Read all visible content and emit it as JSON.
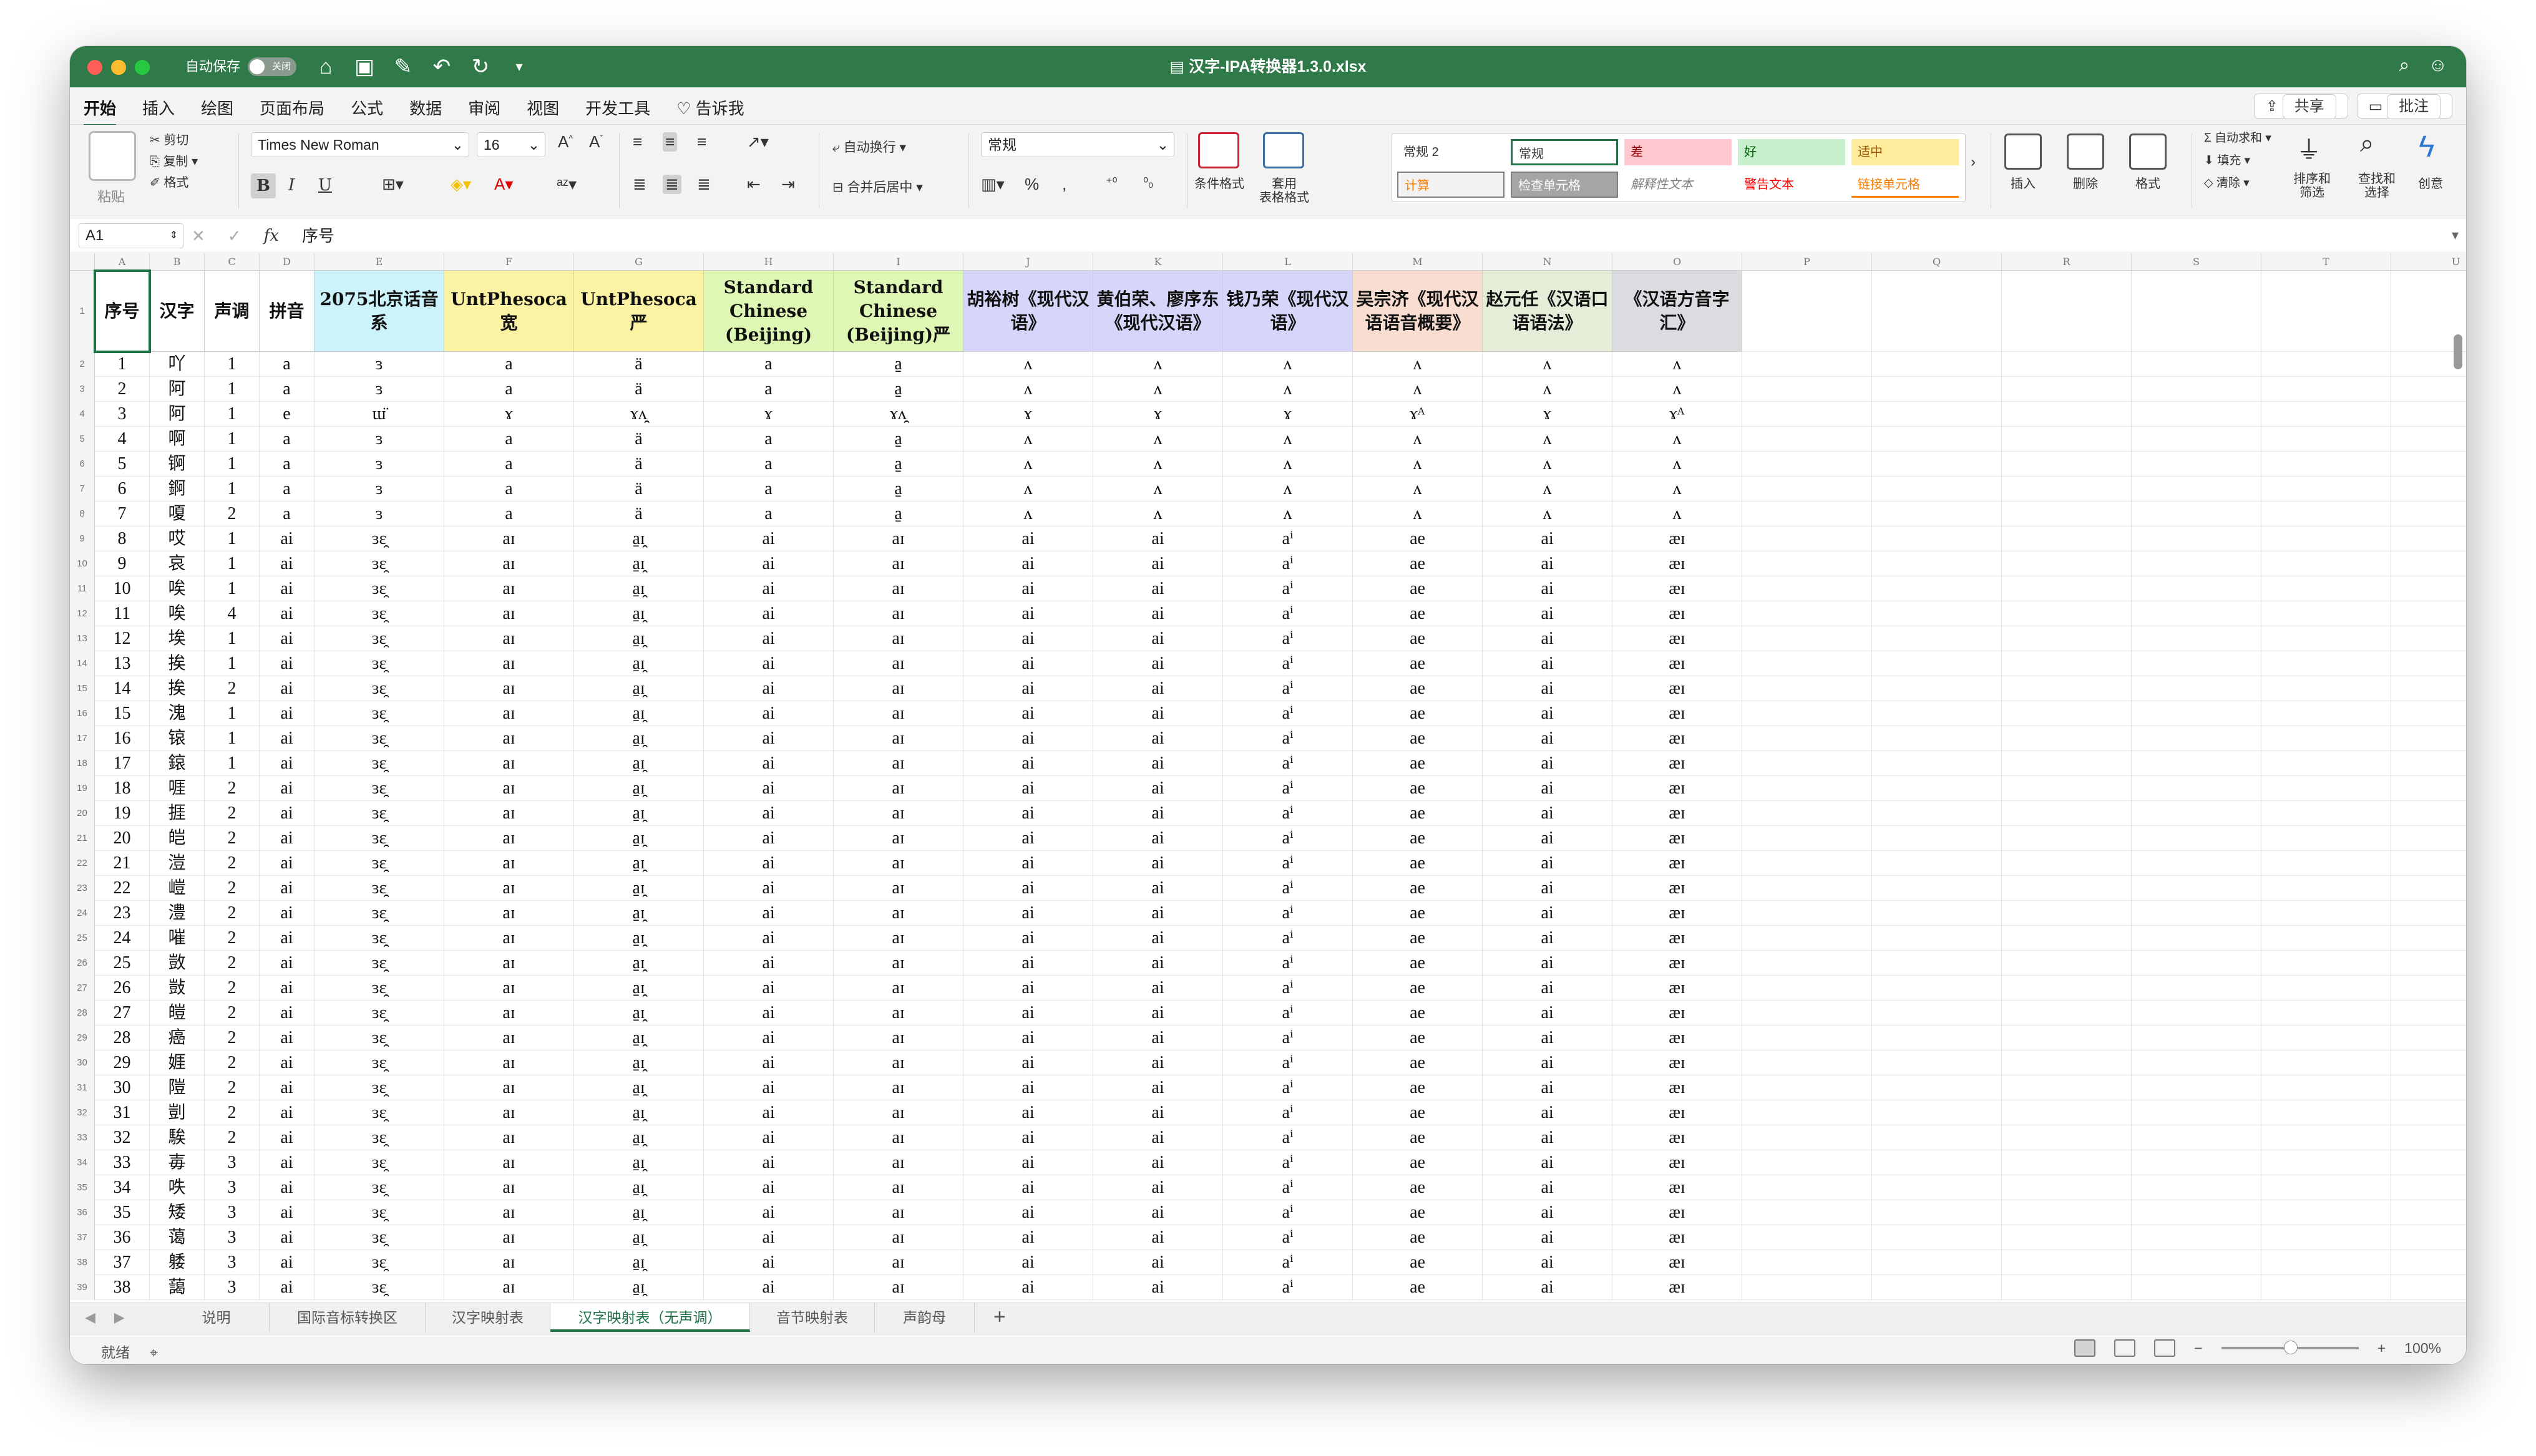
{
  "titlebar": {
    "autosave_label": "自动保存",
    "autosave_state": "关闭",
    "title": "汉字-IPA转换器1.3.0.xlsx"
  },
  "ribbon_tabs": [
    "开始",
    "插入",
    "绘图",
    "页面布局",
    "公式",
    "数据",
    "审阅",
    "视图",
    "开发工具",
    "告诉我"
  ],
  "share": {
    "share_label": "共享",
    "comment_label": "批注"
  },
  "clipboard": {
    "paste": "粘贴",
    "cut": "剪切",
    "copy": "复制",
    "format": "格式"
  },
  "font": {
    "name": "Times New Roman",
    "size": "16",
    "bold": "B",
    "italic": "I",
    "underline": "U"
  },
  "alignment": {
    "wrap": "自动换行",
    "merge": "合并后居中"
  },
  "number": {
    "format": "常规"
  },
  "styles": {
    "conditional": "条件格式",
    "table": "套用\n表格格式",
    "cells": [
      {
        "label": "常规 2",
        "bg": "#ffffff",
        "color": "#333333"
      },
      {
        "label": "常规",
        "bg": "#ffffff",
        "color": "#333333"
      },
      {
        "label": "差",
        "bg": "#ffc7ce",
        "color": "#9c0006"
      },
      {
        "label": "好",
        "bg": "#c6efce",
        "color": "#006100"
      },
      {
        "label": "适中",
        "bg": "#ffeb9c",
        "color": "#9c5700"
      },
      {
        "label": "计算",
        "bg": "#f2f2f2",
        "color": "#fa7d00"
      },
      {
        "label": "检查单元格",
        "bg": "#a5a5a5",
        "color": "#ffffff"
      },
      {
        "label": "解释性文本",
        "bg": "#ffffff",
        "color": "#7f7f7f"
      },
      {
        "label": "警告文本",
        "bg": "#ffffff",
        "color": "#ff0000"
      },
      {
        "label": "链接单元格",
        "bg": "#ffffff",
        "color": "#fa7d00"
      }
    ]
  },
  "cells_group": {
    "insert": "插入",
    "delete": "删除",
    "format": "格式"
  },
  "editing": {
    "autosum": "自动求和",
    "fill": "填充",
    "clear": "清除",
    "sort": "排序和\n筛选",
    "find": "查找和\n选择",
    "ideas": "创意"
  },
  "formula_bar": {
    "name_box": "A1",
    "fx": "fx",
    "content": "序号"
  },
  "columns": [
    "A",
    "B",
    "C",
    "D",
    "E",
    "F",
    "G",
    "H",
    "I",
    "J",
    "K",
    "L",
    "M",
    "N",
    "O",
    "P",
    "Q",
    "R",
    "S",
    "T",
    "U"
  ],
  "headers": [
    {
      "text": "序号",
      "bg": "#ffffff"
    },
    {
      "text": "汉字",
      "bg": "#ffffff"
    },
    {
      "text": "声调",
      "bg": "#ffffff"
    },
    {
      "text": "拼音",
      "bg": "#ffffff"
    },
    {
      "text": "2075北京话音系",
      "bg": "#ccf3fb"
    },
    {
      "text": "UntPhesoca宽",
      "bg": "#fbf3a3"
    },
    {
      "text": "UntPhesoca严",
      "bg": "#fbf3a3"
    },
    {
      "text": "Standard Chinese (Beijing)",
      "bg": "#dff7b4"
    },
    {
      "text": "Standard Chinese (Beijing)严",
      "bg": "#dff7b4"
    },
    {
      "text": "胡裕树《现代汉语》",
      "bg": "#d6d6fb"
    },
    {
      "text": "黄伯荣、廖序东《现代汉语》",
      "bg": "#d6d6fb"
    },
    {
      "text": "钱乃荣《现代汉语》",
      "bg": "#d6d6fb"
    },
    {
      "text": "吴宗济《现代汉语语音概要》",
      "bg": "#f8ddd0"
    },
    {
      "text": "赵元任《汉语口语语法》",
      "bg": "#e4edd8"
    },
    {
      "text": "《汉语方音字汇》",
      "bg": "#dadce0"
    }
  ],
  "rows": [
    [
      "1",
      "吖",
      "1",
      "a",
      "ɜ",
      "a",
      "ä",
      "a",
      "a̠",
      "ʌ",
      "ʌ",
      "ʌ",
      "ʌ",
      "ʌ",
      "ʌ"
    ],
    [
      "2",
      "阿",
      "1",
      "a",
      "ɜ",
      "a",
      "ä",
      "a",
      "a̠",
      "ʌ",
      "ʌ",
      "ʌ",
      "ʌ",
      "ʌ",
      "ʌ"
    ],
    [
      "3",
      "阿",
      "1",
      "e",
      "ɯ̈",
      "ɤ",
      "ɤʌ̯",
      "ɤ",
      "ɤʌ̯",
      "ɤ",
      "ɤ",
      "ɤ",
      "ɤᴬ",
      "ɤ",
      "ɤᴬ"
    ],
    [
      "4",
      "啊",
      "1",
      "a",
      "ɜ",
      "a",
      "ä",
      "a",
      "a̠",
      "ʌ",
      "ʌ",
      "ʌ",
      "ʌ",
      "ʌ",
      "ʌ"
    ],
    [
      "5",
      "锕",
      "1",
      "a",
      "ɜ",
      "a",
      "ä",
      "a",
      "a̠",
      "ʌ",
      "ʌ",
      "ʌ",
      "ʌ",
      "ʌ",
      "ʌ"
    ],
    [
      "6",
      "錒",
      "1",
      "a",
      "ɜ",
      "a",
      "ä",
      "a",
      "a̠",
      "ʌ",
      "ʌ",
      "ʌ",
      "ʌ",
      "ʌ",
      "ʌ"
    ],
    [
      "7",
      "嗄",
      "2",
      "a",
      "ɜ",
      "a",
      "ä",
      "a",
      "a̠",
      "ʌ",
      "ʌ",
      "ʌ",
      "ʌ",
      "ʌ",
      "ʌ"
    ],
    [
      "8",
      "哎",
      "1",
      "ai",
      "ɜɛ̯",
      "aɪ",
      "a̠ɪ̯",
      "ai",
      "aɪ",
      "ai",
      "ai",
      "aⁱ",
      "ae",
      "ai",
      "æɪ"
    ],
    [
      "9",
      "哀",
      "1",
      "ai",
      "ɜɛ̯",
      "aɪ",
      "a̠ɪ̯",
      "ai",
      "aɪ",
      "ai",
      "ai",
      "aⁱ",
      "ae",
      "ai",
      "æɪ"
    ],
    [
      "10",
      "唉",
      "1",
      "ai",
      "ɜɛ̯",
      "aɪ",
      "a̠ɪ̯",
      "ai",
      "aɪ",
      "ai",
      "ai",
      "aⁱ",
      "ae",
      "ai",
      "æɪ"
    ],
    [
      "11",
      "唉",
      "4",
      "ai",
      "ɜɛ̯",
      "aɪ",
      "a̠ɪ̯",
      "ai",
      "aɪ",
      "ai",
      "ai",
      "aⁱ",
      "ae",
      "ai",
      "æɪ"
    ],
    [
      "12",
      "埃",
      "1",
      "ai",
      "ɜɛ̯",
      "aɪ",
      "a̠ɪ̯",
      "ai",
      "aɪ",
      "ai",
      "ai",
      "aⁱ",
      "ae",
      "ai",
      "æɪ"
    ],
    [
      "13",
      "挨",
      "1",
      "ai",
      "ɜɛ̯",
      "aɪ",
      "a̠ɪ̯",
      "ai",
      "aɪ",
      "ai",
      "ai",
      "aⁱ",
      "ae",
      "ai",
      "æɪ"
    ],
    [
      "14",
      "挨",
      "2",
      "ai",
      "ɜɛ̯",
      "aɪ",
      "a̠ɪ̯",
      "ai",
      "aɪ",
      "ai",
      "ai",
      "aⁱ",
      "ae",
      "ai",
      "æɪ"
    ],
    [
      "15",
      "溾",
      "1",
      "ai",
      "ɜɛ̯",
      "aɪ",
      "a̠ɪ̯",
      "ai",
      "aɪ",
      "ai",
      "ai",
      "aⁱ",
      "ae",
      "ai",
      "æɪ"
    ],
    [
      "16",
      "锿",
      "1",
      "ai",
      "ɜɛ̯",
      "aɪ",
      "a̠ɪ̯",
      "ai",
      "aɪ",
      "ai",
      "ai",
      "aⁱ",
      "ae",
      "ai",
      "æɪ"
    ],
    [
      "17",
      "鎄",
      "1",
      "ai",
      "ɜɛ̯",
      "aɪ",
      "a̠ɪ̯",
      "ai",
      "aɪ",
      "ai",
      "ai",
      "aⁱ",
      "ae",
      "ai",
      "æɪ"
    ],
    [
      "18",
      "啀",
      "2",
      "ai",
      "ɜɛ̯",
      "aɪ",
      "a̠ɪ̯",
      "ai",
      "aɪ",
      "ai",
      "ai",
      "aⁱ",
      "ae",
      "ai",
      "æɪ"
    ],
    [
      "19",
      "捱",
      "2",
      "ai",
      "ɜɛ̯",
      "aɪ",
      "a̠ɪ̯",
      "ai",
      "aɪ",
      "ai",
      "ai",
      "aⁱ",
      "ae",
      "ai",
      "æɪ"
    ],
    [
      "20",
      "皑",
      "2",
      "ai",
      "ɜɛ̯",
      "aɪ",
      "a̠ɪ̯",
      "ai",
      "aɪ",
      "ai",
      "ai",
      "aⁱ",
      "ae",
      "ai",
      "æɪ"
    ],
    [
      "21",
      "溰",
      "2",
      "ai",
      "ɜɛ̯",
      "aɪ",
      "a̠ɪ̯",
      "ai",
      "aɪ",
      "ai",
      "ai",
      "aⁱ",
      "ae",
      "ai",
      "æɪ"
    ],
    [
      "22",
      "嵦",
      "2",
      "ai",
      "ɜɛ̯",
      "aɪ",
      "a̠ɪ̯",
      "ai",
      "aɪ",
      "ai",
      "ai",
      "aⁱ",
      "ae",
      "ai",
      "æɪ"
    ],
    [
      "23",
      "澧",
      "2",
      "ai",
      "ɜɛ̯",
      "aɪ",
      "a̠ɪ̯",
      "ai",
      "aɪ",
      "ai",
      "ai",
      "aⁱ",
      "ae",
      "ai",
      "æɪ"
    ],
    [
      "24",
      "嗺",
      "2",
      "ai",
      "ɜɛ̯",
      "aɪ",
      "a̠ɪ̯",
      "ai",
      "aɪ",
      "ai",
      "ai",
      "aⁱ",
      "ae",
      "ai",
      "æɪ"
    ],
    [
      "25",
      "敳",
      "2",
      "ai",
      "ɜɛ̯",
      "aɪ",
      "a̠ɪ̯",
      "ai",
      "aɪ",
      "ai",
      "ai",
      "aⁱ",
      "ae",
      "ai",
      "æɪ"
    ],
    [
      "26",
      "敱",
      "2",
      "ai",
      "ɜɛ̯",
      "aɪ",
      "a̠ɪ̯",
      "ai",
      "aɪ",
      "ai",
      "ai",
      "aⁱ",
      "ae",
      "ai",
      "æɪ"
    ],
    [
      "27",
      "皚",
      "2",
      "ai",
      "ɜɛ̯",
      "aɪ",
      "a̠ɪ̯",
      "ai",
      "aɪ",
      "ai",
      "ai",
      "aⁱ",
      "ae",
      "ai",
      "æɪ"
    ],
    [
      "28",
      "癌",
      "2",
      "ai",
      "ɜɛ̯",
      "aɪ",
      "a̠ɪ̯",
      "ai",
      "aɪ",
      "ai",
      "ai",
      "aⁱ",
      "ae",
      "ai",
      "æɪ"
    ],
    [
      "29",
      "娾",
      "2",
      "ai",
      "ɜɛ̯",
      "aɪ",
      "a̠ɪ̯",
      "ai",
      "aɪ",
      "ai",
      "ai",
      "aⁱ",
      "ae",
      "ai",
      "æɪ"
    ],
    [
      "30",
      "隑",
      "2",
      "ai",
      "ɜɛ̯",
      "aɪ",
      "a̠ɪ̯",
      "ai",
      "aɪ",
      "ai",
      "ai",
      "aⁱ",
      "ae",
      "ai",
      "æɪ"
    ],
    [
      "31",
      "剴",
      "2",
      "ai",
      "ɜɛ̯",
      "aɪ",
      "a̠ɪ̯",
      "ai",
      "aɪ",
      "ai",
      "ai",
      "aⁱ",
      "ae",
      "ai",
      "æɪ"
    ],
    [
      "32",
      "騃",
      "2",
      "ai",
      "ɜɛ̯",
      "aɪ",
      "a̠ɪ̯",
      "ai",
      "aɪ",
      "ai",
      "ai",
      "aⁱ",
      "ae",
      "ai",
      "æɪ"
    ],
    [
      "33",
      "毐",
      "3",
      "ai",
      "ɜɛ̯",
      "aɪ",
      "a̠ɪ̯",
      "ai",
      "aɪ",
      "ai",
      "ai",
      "aⁱ",
      "ae",
      "ai",
      "æɪ"
    ],
    [
      "34",
      "呹",
      "3",
      "ai",
      "ɜɛ̯",
      "aɪ",
      "a̠ɪ̯",
      "ai",
      "aɪ",
      "ai",
      "ai",
      "aⁱ",
      "ae",
      "ai",
      "æɪ"
    ],
    [
      "35",
      "矮",
      "3",
      "ai",
      "ɜɛ̯",
      "aɪ",
      "a̠ɪ̯",
      "ai",
      "aɪ",
      "ai",
      "ai",
      "aⁱ",
      "ae",
      "ai",
      "æɪ"
    ],
    [
      "36",
      "蔼",
      "3",
      "ai",
      "ɜɛ̯",
      "aɪ",
      "a̠ɪ̯",
      "ai",
      "aɪ",
      "ai",
      "ai",
      "aⁱ",
      "ae",
      "ai",
      "æɪ"
    ],
    [
      "37",
      "躷",
      "3",
      "ai",
      "ɜɛ̯",
      "aɪ",
      "a̠ɪ̯",
      "ai",
      "aɪ",
      "ai",
      "ai",
      "aⁱ",
      "ae",
      "ai",
      "æɪ"
    ],
    [
      "38",
      "藹",
      "3",
      "ai",
      "ɜɛ̯",
      "aɪ",
      "a̠ɪ̯",
      "ai",
      "aɪ",
      "ai",
      "ai",
      "aⁱ",
      "ae",
      "ai",
      "æɪ"
    ]
  ],
  "sheets": [
    "说明",
    "国际音标转换区",
    "汉字映射表",
    "汉字映射表（无声调）",
    "音节映射表",
    "声韵母"
  ],
  "active_sheet_index": 3,
  "status": {
    "ready": "就绪",
    "zoom": "100%"
  }
}
